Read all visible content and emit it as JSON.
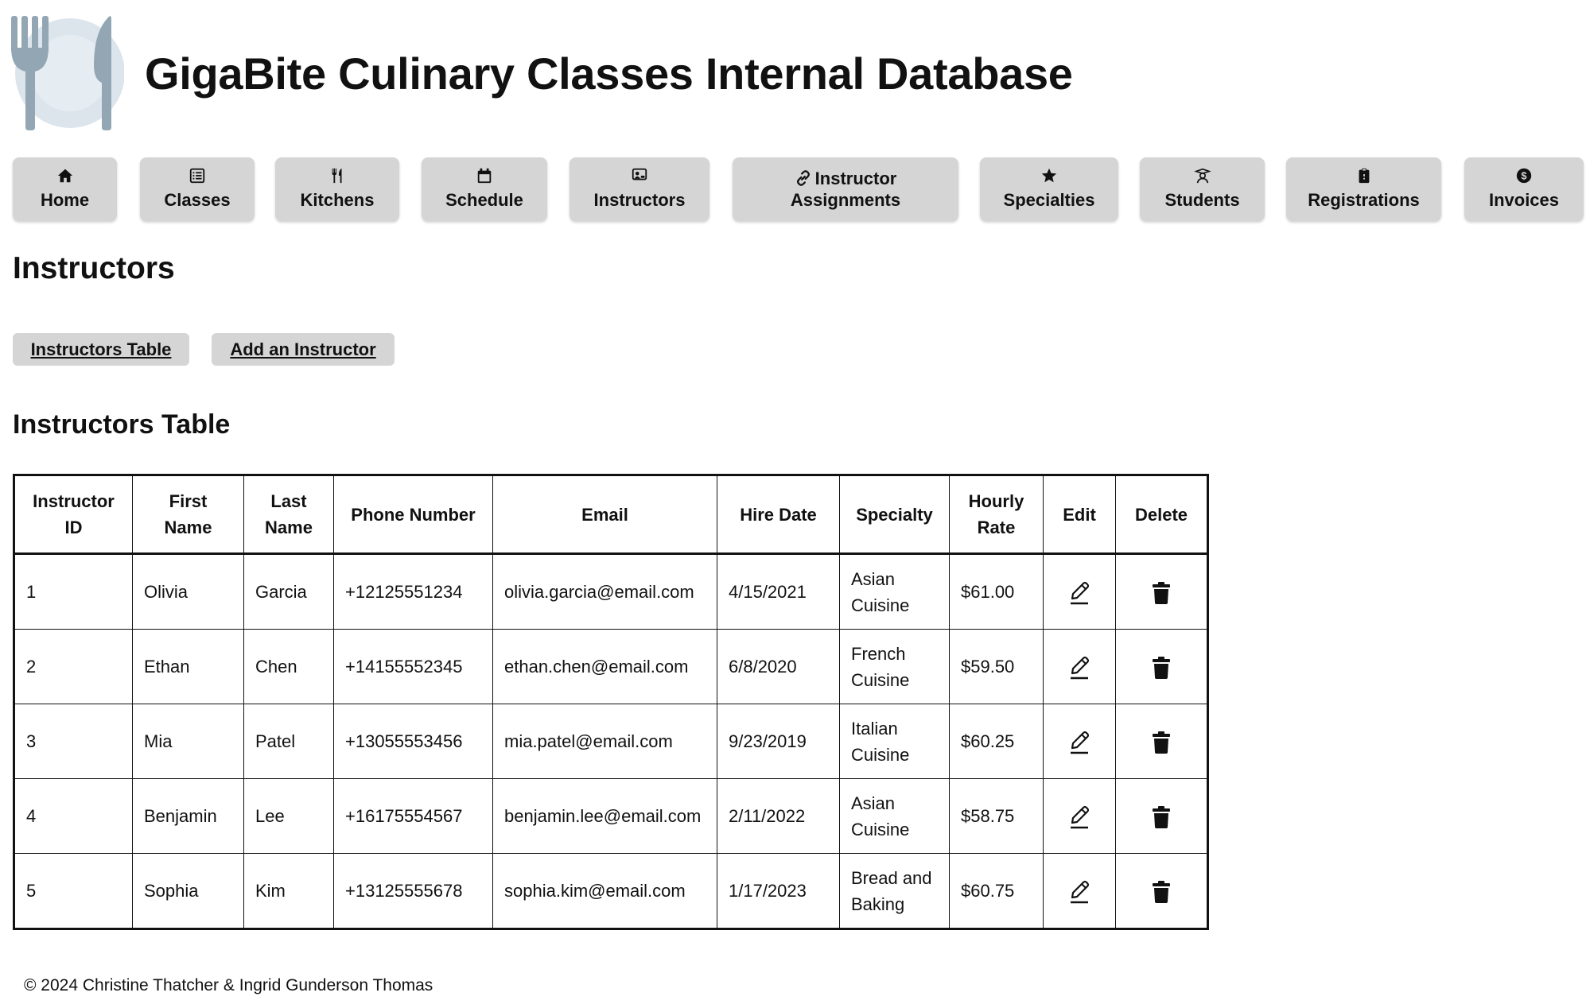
{
  "header": {
    "logo_icon": "plate-fork-knife-icon",
    "title": "GigaBite Culinary Classes Internal Database"
  },
  "nav": {
    "items": [
      {
        "label": "Home",
        "icon": "home-icon"
      },
      {
        "label": "Classes",
        "icon": "list-icon"
      },
      {
        "label": "Kitchens",
        "icon": "utensils-icon"
      },
      {
        "label": "Schedule",
        "icon": "calendar-icon"
      },
      {
        "label": "Instructors",
        "icon": "chalkboard-user-icon"
      },
      {
        "label_line1": "Instructor",
        "label_line2": "Assignments",
        "icon": "link-icon"
      },
      {
        "label": "Specialties",
        "icon": "star-icon"
      },
      {
        "label": "Students",
        "icon": "user-graduate-icon"
      },
      {
        "label": "Registrations",
        "icon": "clipboard-icon"
      },
      {
        "label": "Invoices",
        "icon": "dollar-circle-icon"
      }
    ]
  },
  "page": {
    "heading": "Instructors"
  },
  "sub_nav": {
    "table_label": "Instructors Table",
    "add_label": "Add an Instructor"
  },
  "table": {
    "heading": "Instructors Table",
    "columns": [
      {
        "line1": "Instructor",
        "line2": "ID"
      },
      {
        "line1": "First Name"
      },
      {
        "line1": "Last",
        "line2": "Name"
      },
      {
        "line1": "Phone Number"
      },
      {
        "line1": "Email"
      },
      {
        "line1": "Hire Date"
      },
      {
        "line1": "Specialty"
      },
      {
        "line1": "Hourly",
        "line2": "Rate"
      },
      {
        "line1": "Edit"
      },
      {
        "line1": "Delete"
      }
    ],
    "rows": [
      {
        "id": "1",
        "first": "Olivia",
        "last": "Garcia",
        "phone": "+12125551234",
        "email": "olivia.garcia@email.com",
        "hire": "4/15/2021",
        "spec1": "Asian",
        "spec2": "Cuisine",
        "rate": "$61.00"
      },
      {
        "id": "2",
        "first": "Ethan",
        "last": "Chen",
        "phone": "+14155552345",
        "email": "ethan.chen@email.com",
        "hire": "6/8/2020",
        "spec1": "French",
        "spec2": "Cuisine",
        "rate": "$59.50"
      },
      {
        "id": "3",
        "first": "Mia",
        "last": "Patel",
        "phone": "+13055553456",
        "email": "mia.patel@email.com",
        "hire": "9/23/2019",
        "spec1": "Italian",
        "spec2": "Cuisine",
        "rate": "$60.25"
      },
      {
        "id": "4",
        "first": "Benjamin",
        "last": "Lee",
        "phone": "+16175554567",
        "email": "benjamin.lee@email.com",
        "hire": "2/11/2022",
        "spec1": "Asian",
        "spec2": "Cuisine",
        "rate": "$58.75"
      },
      {
        "id": "5",
        "first": "Sophia",
        "last": "Kim",
        "phone": "+13125555678",
        "email": "sophia.kim@email.com",
        "hire": "1/17/2023",
        "spec1": "Bread and",
        "spec2": "Baking",
        "rate": "$60.75"
      }
    ],
    "edit_icon": "pencil-icon",
    "delete_icon": "trash-icon"
  },
  "footer": {
    "text": "© 2024 Christine Thatcher & Ingrid Gunderson Thomas"
  },
  "colors": {
    "button_bg": "#d5d5d5",
    "logo_plate": "#dde5ec",
    "logo_utensils": "#93a6b4",
    "text": "#111111"
  }
}
